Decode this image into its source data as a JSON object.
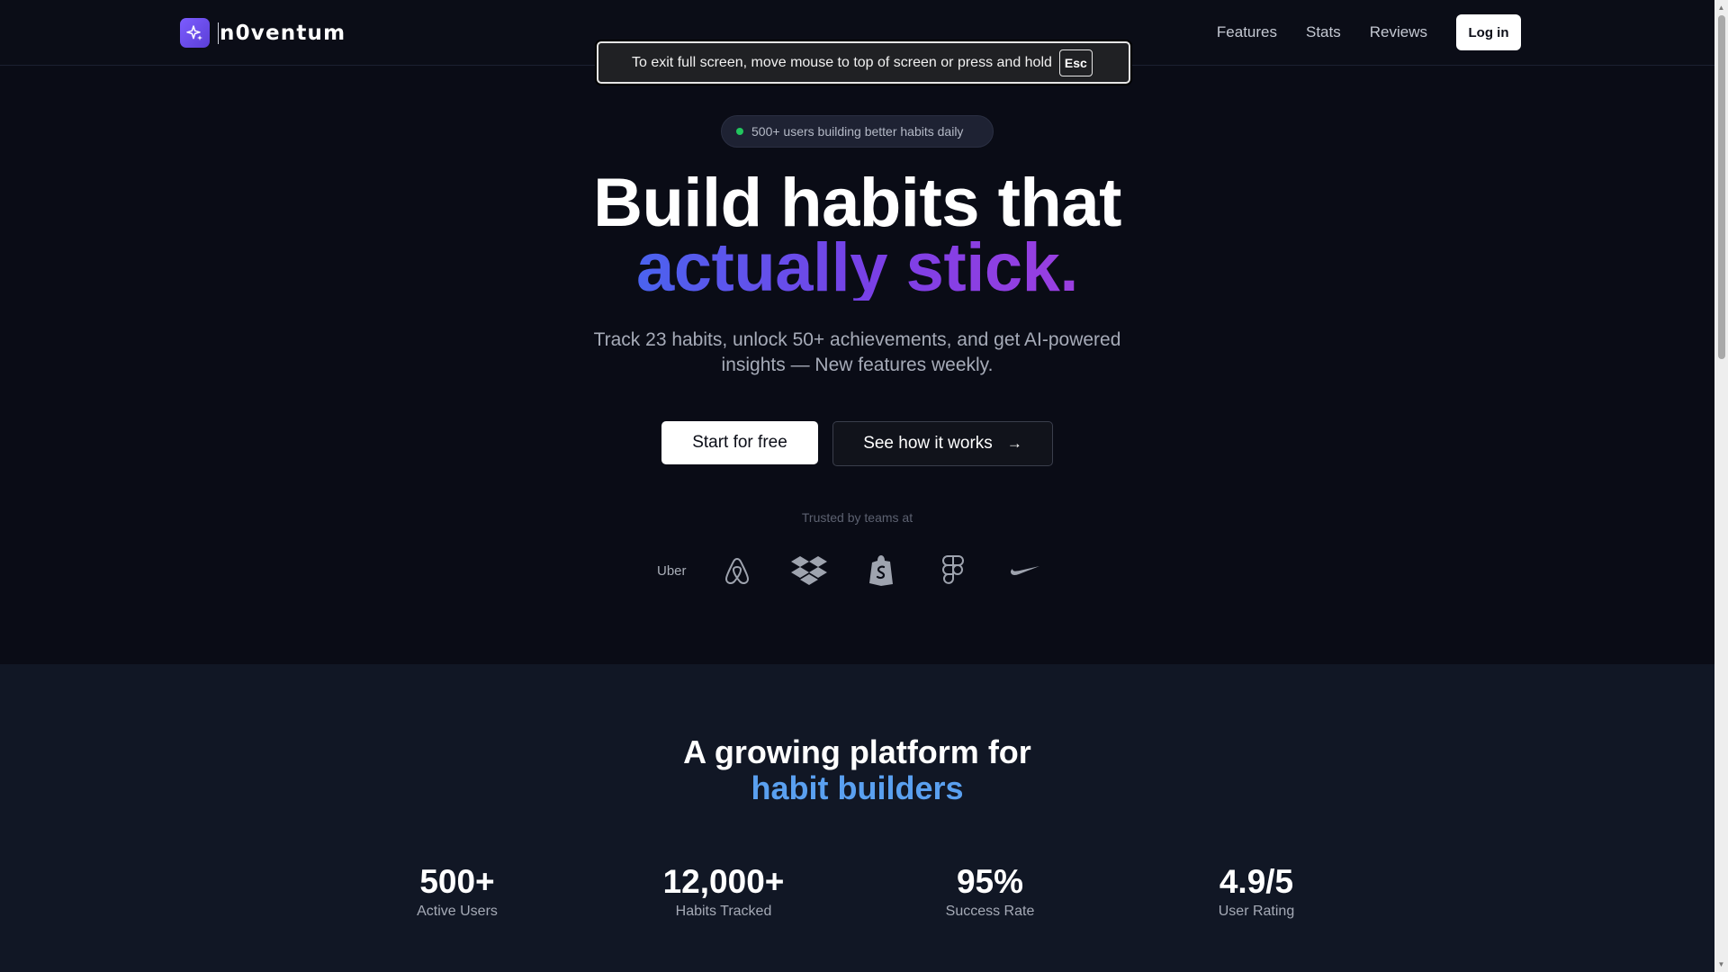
{
  "header": {
    "brand_name": "n0ventum",
    "nav": [
      {
        "label": "Features"
      },
      {
        "label": "Stats"
      },
      {
        "label": "Reviews"
      }
    ],
    "login_label": "Log in"
  },
  "fullscreen_toast": {
    "message": "To exit full screen, move mouse to top of screen or press and hold",
    "key": "Esc"
  },
  "hero": {
    "badge": "500+ users building better habits daily",
    "headline_line1": "Build habits that",
    "headline_line2": "actually stick.",
    "subtitle": "Track 23 habits, unlock 50+ achievements, and get AI-powered insights — New features weekly.",
    "cta_primary": "Start for free",
    "cta_secondary": "See how it works",
    "trusted_by": "Trusted by teams at",
    "logos": [
      {
        "name": "Uber",
        "icon": "uber-logo"
      },
      {
        "name": "Airbnb",
        "icon": "airbnb-logo"
      },
      {
        "name": "Dropbox",
        "icon": "dropbox-logo"
      },
      {
        "name": "Shopify",
        "icon": "shopify-logo"
      },
      {
        "name": "Figma",
        "icon": "figma-logo"
      },
      {
        "name": "Nike",
        "icon": "nike-logo"
      }
    ]
  },
  "stats": {
    "title_line1": "A growing platform for",
    "title_line2": "habit builders",
    "items": [
      {
        "value": "500+",
        "label": "Active Users"
      },
      {
        "value": "12,000+",
        "label": "Habits Tracked"
      },
      {
        "value": "95%",
        "label": "Success Rate"
      },
      {
        "value": "4.9/5",
        "label": "User Rating"
      }
    ]
  },
  "colors": {
    "background": "#0b0d17",
    "stats_background": "#111725",
    "accent_blue": "#5aa0f0",
    "gradient_start": "#4a63ef",
    "gradient_end": "#9b3fe0",
    "badge_dot": "#22c55e"
  }
}
